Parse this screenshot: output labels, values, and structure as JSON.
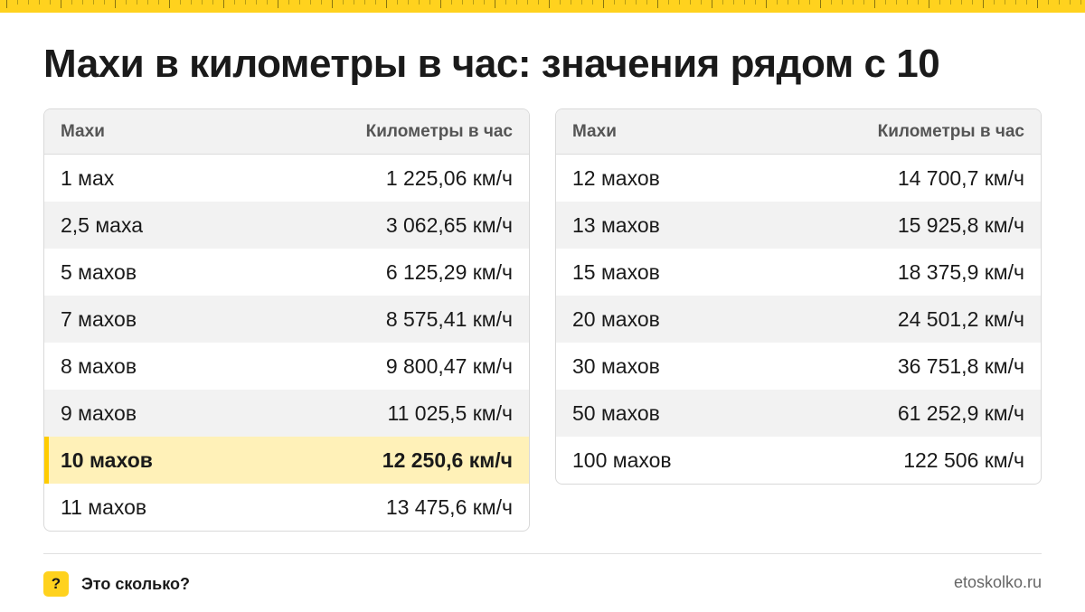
{
  "title": "Махи в километры в час: значения рядом с 10",
  "accent_color": "#ffd21e",
  "highlight_color": "#fff1b8",
  "left_table": {
    "headers": [
      "Махи",
      "Километры в час"
    ],
    "rows": [
      [
        "1 мах",
        "1 225,06 км/ч"
      ],
      [
        "2,5 маха",
        "3 062,65 км/ч"
      ],
      [
        "5 махов",
        "6 125,29 км/ч"
      ],
      [
        "7 махов",
        "8 575,41 км/ч"
      ],
      [
        "8 махов",
        "9 800,47 км/ч"
      ],
      [
        "9 махов",
        "11 025,5 км/ч"
      ],
      [
        "10 махов",
        "12 250,6 км/ч"
      ],
      [
        "11 махов",
        "13 475,6 км/ч"
      ]
    ],
    "highlighted_row": 6
  },
  "right_table": {
    "headers": [
      "Махи",
      "Километры в час"
    ],
    "rows": [
      [
        "12 махов",
        "14 700,7 км/ч"
      ],
      [
        "13 махов",
        "15 925,8 км/ч"
      ],
      [
        "15 махов",
        "18 375,9 км/ч"
      ],
      [
        "20 махов",
        "24 501,2 км/ч"
      ],
      [
        "30 махов",
        "36 751,8 км/ч"
      ],
      [
        "50 махов",
        "61 252,9 км/ч"
      ],
      [
        "100 махов",
        "122 506 км/ч"
      ]
    ]
  },
  "footer": {
    "brand_icon": "?",
    "brand_name": "Это сколько?",
    "site": "etoskolko.ru"
  }
}
